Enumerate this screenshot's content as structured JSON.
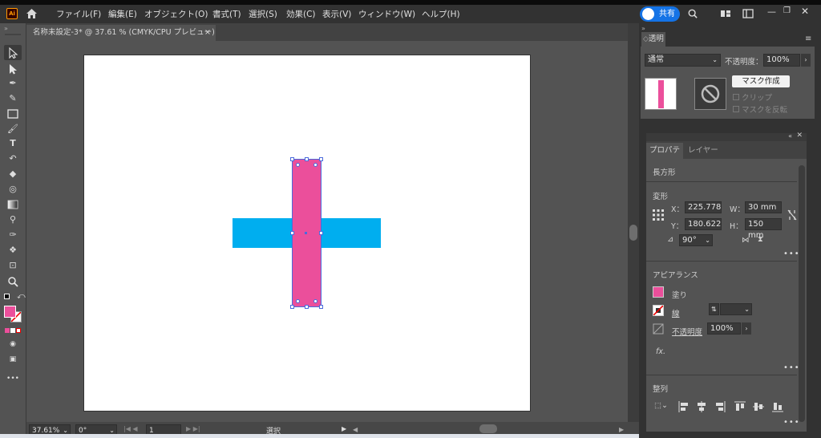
{
  "app": {
    "logo": "Ai",
    "share_label": "共有"
  },
  "menu": [
    "ファイル(F)",
    "編集(E)",
    "オブジェクト(O)",
    "書式(T)",
    "選択(S)",
    "効果(C)",
    "表示(V)",
    "ウィンドウ(W)",
    "ヘルプ(H)"
  ],
  "document_tab": {
    "title": "名称未設定-3* @ 37.61 % (CMYK/CPU プレビュー)",
    "close": "×"
  },
  "status": {
    "zoom": "37.61%",
    "rotation": "0°",
    "artboard": "1",
    "mode": "選択"
  },
  "transparency": {
    "tab": "透明",
    "blend_mode": "通常",
    "opacity_label": "不透明度：",
    "opacity_value": "100%",
    "make_mask": "マスク作成",
    "clip": "クリップ",
    "invert_mask": "マスクを反転"
  },
  "properties": {
    "tabs": [
      "プロパティ",
      "レイヤー"
    ],
    "object_type": "長方形",
    "transform": {
      "header": "変形",
      "x_label": "X：",
      "x": "225.778",
      "y_label": "Y：",
      "y": "180.622",
      "w_label": "W：",
      "w": "30 mm",
      "h_label": "H：",
      "h": "150 mm",
      "angle": "90°"
    },
    "appearance": {
      "header": "アピアランス",
      "fill": "塗り",
      "stroke": "線",
      "opacity_label": "不透明度",
      "opacity": "100%",
      "fx": "fx."
    },
    "align": {
      "header": "整列"
    },
    "more": "•••"
  },
  "colors": {
    "fill": "#eb4f9b",
    "accent_blue": "#00aeef",
    "selection": "#4a6bdc"
  }
}
